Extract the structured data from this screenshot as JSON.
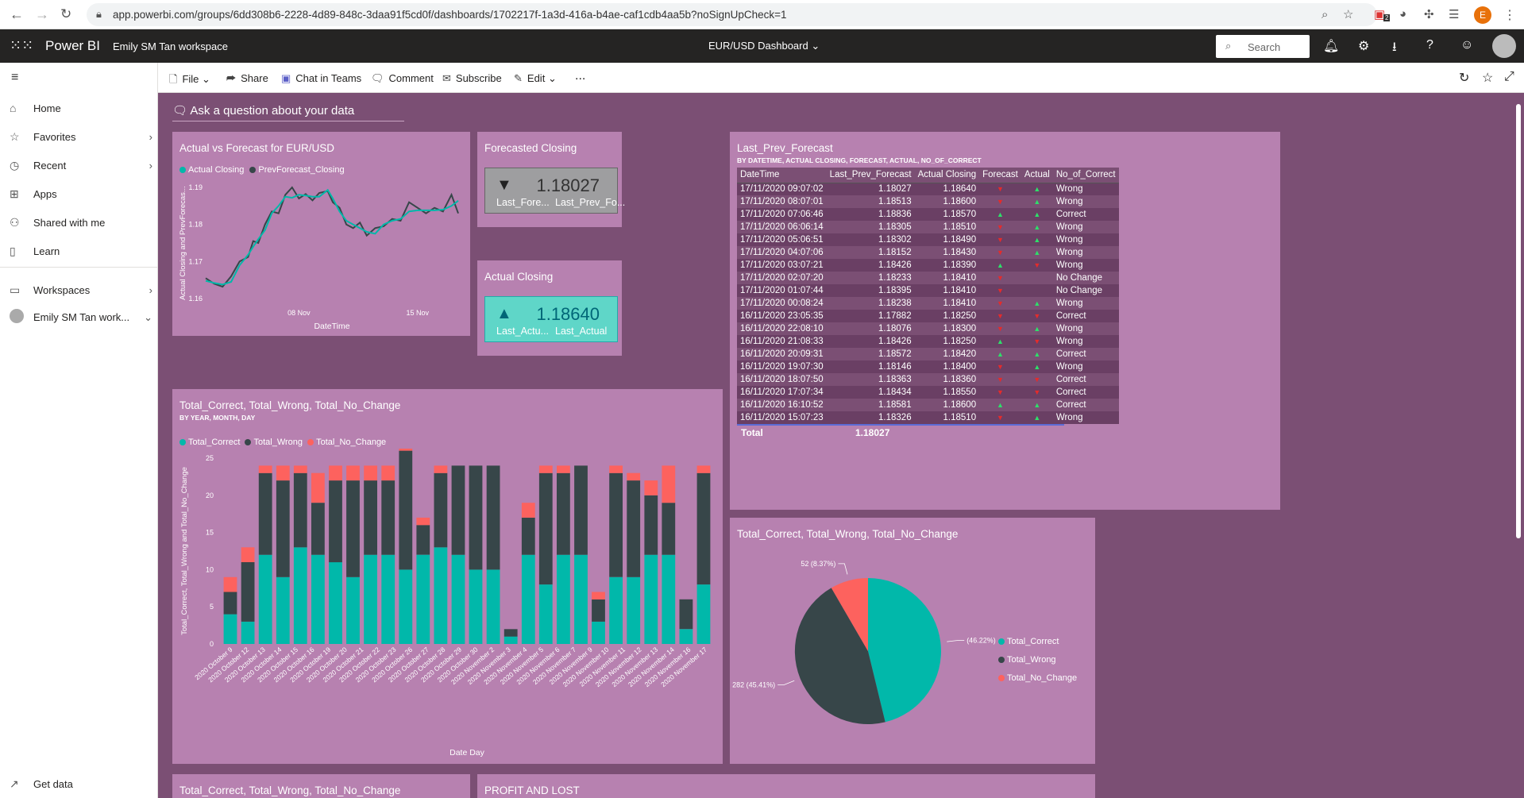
{
  "browser": {
    "url": "app.powerbi.com/groups/6dd308b6-2228-4d89-848c-3daa91f5cd0f/dashboards/1702217f-1a3d-416a-b4ae-caf1cdb4aa5b?noSignUpCheck=1",
    "profile_initial": "E",
    "extension_badge": "2"
  },
  "header": {
    "app_name": "Power BI",
    "workspace": "Emily SM Tan workspace",
    "dashboard_title": "EUR/USD Dashboard",
    "search_placeholder": "Search"
  },
  "sidebar": {
    "items": [
      {
        "label": "Home",
        "icon": "home-icon"
      },
      {
        "label": "Favorites",
        "icon": "star-icon"
      },
      {
        "label": "Recent",
        "icon": "clock-icon"
      },
      {
        "label": "Apps",
        "icon": "apps-icon"
      },
      {
        "label": "Shared with me",
        "icon": "share-person-icon"
      },
      {
        "label": "Learn",
        "icon": "book-icon"
      },
      {
        "label": "Workspaces",
        "icon": "workspaces-icon"
      },
      {
        "label": "Emily SM Tan work...",
        "icon": "workspace-avatar-icon"
      }
    ],
    "get_data": "Get data"
  },
  "toolbar": {
    "file": "File",
    "share": "Share",
    "teams": "Chat in Teams",
    "comment": "Comment",
    "subscribe": "Subscribe",
    "edit": "Edit",
    "more": "..."
  },
  "qa_prompt": "Ask a question about your data",
  "colors": {
    "canvas": "#7b4f74",
    "tile": "#b781b0",
    "correct": "#01b8aa",
    "wrong": "#374649",
    "no_change": "#fd625e",
    "up": "#2ee06a",
    "down": "#e52b2b"
  },
  "tiles": {
    "line": {
      "title": "Actual vs Forecast for EUR/USD",
      "legend": [
        "Actual Closing",
        "PrevForecast_Closing"
      ]
    },
    "forecast_card": {
      "title": "Forecasted Closing",
      "value": "1.18027",
      "arrow": "▼",
      "label1": "Last_Fore...",
      "label2": "Last_Prev_Fo..."
    },
    "actual_card": {
      "title": "Actual Closing",
      "value": "1.18640",
      "arrow": "▲",
      "label1": "Last_Actu...",
      "label2": "Last_Actual"
    },
    "table": {
      "title": "Last_Prev_Forecast",
      "subtitle": "BY DATETIME, ACTUAL CLOSING, FORECAST, ACTUAL, NO_OF_CORRECT",
      "headers": [
        "DateTime",
        "Last_Prev_Forecast",
        "Actual Closing",
        "Forecast",
        "Actual",
        "No_of_Correct"
      ],
      "rows": [
        [
          "17/11/2020 09:07:02",
          "1.18027",
          "1.18640",
          "down",
          "up",
          "Wrong"
        ],
        [
          "17/11/2020 08:07:01",
          "1.18513",
          "1.18600",
          "down",
          "up",
          "Wrong"
        ],
        [
          "17/11/2020 07:06:46",
          "1.18836",
          "1.18570",
          "up",
          "up",
          "Correct"
        ],
        [
          "17/11/2020 06:06:14",
          "1.18305",
          "1.18510",
          "down",
          "up",
          "Wrong"
        ],
        [
          "17/11/2020 05:06:51",
          "1.18302",
          "1.18490",
          "down",
          "up",
          "Wrong"
        ],
        [
          "17/11/2020 04:07:06",
          "1.18152",
          "1.18430",
          "down",
          "up",
          "Wrong"
        ],
        [
          "17/11/2020 03:07:21",
          "1.18426",
          "1.18390",
          "up",
          "down",
          "Wrong"
        ],
        [
          "17/11/2020 02:07:20",
          "1.18233",
          "1.18410",
          "down",
          "",
          "No Change"
        ],
        [
          "17/11/2020 01:07:44",
          "1.18395",
          "1.18410",
          "down",
          "",
          "No Change"
        ],
        [
          "17/11/2020 00:08:24",
          "1.18238",
          "1.18410",
          "down",
          "up",
          "Wrong"
        ],
        [
          "16/11/2020 23:05:35",
          "1.17882",
          "1.18250",
          "down",
          "down",
          "Correct"
        ],
        [
          "16/11/2020 22:08:10",
          "1.18076",
          "1.18300",
          "down",
          "up",
          "Wrong"
        ],
        [
          "16/11/2020 21:08:33",
          "1.18426",
          "1.18250",
          "up",
          "down",
          "Wrong"
        ],
        [
          "16/11/2020 20:09:31",
          "1.18572",
          "1.18420",
          "up",
          "up",
          "Correct"
        ],
        [
          "16/11/2020 19:07:30",
          "1.18146",
          "1.18400",
          "down",
          "up",
          "Wrong"
        ],
        [
          "16/11/2020 18:07:50",
          "1.18363",
          "1.18360",
          "down",
          "down",
          "Correct"
        ],
        [
          "16/11/2020 17:07:34",
          "1.18434",
          "1.18550",
          "down",
          "down",
          "Correct"
        ],
        [
          "16/11/2020 16:10:52",
          "1.18581",
          "1.18600",
          "up",
          "up",
          "Correct"
        ],
        [
          "16/11/2020 15:07:23",
          "1.18326",
          "1.18510",
          "down",
          "up",
          "Wrong"
        ]
      ],
      "total_label": "Total",
      "total_value": "1.18027"
    },
    "stacked": {
      "title": "Total_Correct, Total_Wrong, Total_No_Change",
      "subtitle": "BY YEAR, MONTH, DAY",
      "legend": [
        "Total_Correct",
        "Total_Wrong",
        "Total_No_Change"
      ]
    },
    "pie": {
      "title": "Total_Correct, Total_Wrong, Total_No_Change",
      "legend": [
        "Total_Correct",
        "Total_Wrong",
        "Total_No_Change"
      ]
    },
    "bottom_left": {
      "title": "Total_Correct, Total_Wrong, Total_No_Change"
    },
    "bottom_right": {
      "title": "PROFIT AND LOST"
    }
  },
  "chart_data": [
    {
      "type": "line",
      "title": "Actual vs Forecast for EUR/USD",
      "xlabel": "DateTime",
      "ylabel": "Actual Closing and PrevForecas...",
      "ylim": [
        1.16,
        1.19
      ],
      "y_ticks": [
        "1.16",
        "1.17",
        "1.18",
        "1.19"
      ],
      "x_ticks": [
        "08 Nov",
        "15 Nov"
      ],
      "x_tick_days": [
        8,
        15
      ],
      "xlim_days": [
        2.5,
        17.4
      ],
      "series": [
        {
          "name": "Actual Closing",
          "color": "#01b8aa",
          "x": [
            2.5,
            3.0,
            3.5,
            4.0,
            4.5,
            5.0,
            5.3,
            5.6,
            6.0,
            6.4,
            6.8,
            7.2,
            7.6,
            8.0,
            8.4,
            8.8,
            9.2,
            9.7,
            10.0,
            10.4,
            10.8,
            11.2,
            11.6,
            12.0,
            12.5,
            13.0,
            13.5,
            14.0,
            14.5,
            15.0,
            15.5,
            16.0,
            16.5,
            17.0,
            17.4
          ],
          "y": [
            1.1648,
            1.1642,
            1.1638,
            1.1645,
            1.169,
            1.1718,
            1.174,
            1.176,
            1.1785,
            1.183,
            1.185,
            1.1875,
            1.1872,
            1.188,
            1.1878,
            1.1875,
            1.1875,
            1.1893,
            1.187,
            1.1835,
            1.181,
            1.18,
            1.179,
            1.178,
            1.1775,
            1.18,
            1.181,
            1.1815,
            1.1835,
            1.1838,
            1.1838,
            1.1838,
            1.184,
            1.185,
            1.1864
          ]
        },
        {
          "name": "PrevForecast_Closing",
          "color": "#374649",
          "x": [
            2.5,
            3.0,
            3.5,
            4.0,
            4.5,
            5.0,
            5.3,
            5.6,
            6.0,
            6.4,
            6.8,
            7.2,
            7.6,
            8.0,
            8.4,
            8.8,
            9.2,
            9.7,
            10.0,
            10.4,
            10.8,
            11.2,
            11.6,
            12.0,
            12.5,
            13.0,
            13.5,
            14.0,
            14.5,
            15.0,
            15.5,
            16.0,
            16.5,
            17.0,
            17.4
          ],
          "y": [
            1.1655,
            1.164,
            1.1632,
            1.166,
            1.17,
            1.1712,
            1.1755,
            1.175,
            1.18,
            1.1835,
            1.183,
            1.188,
            1.19,
            1.187,
            1.1882,
            1.1865,
            1.1885,
            1.189,
            1.186,
            1.1845,
            1.18,
            1.179,
            1.1805,
            1.177,
            1.179,
            1.1795,
            1.1815,
            1.181,
            1.186,
            1.1845,
            1.183,
            1.1845,
            1.1835,
            1.188,
            1.183
          ]
        }
      ]
    },
    {
      "type": "bar",
      "title": "Total_Correct, Total_Wrong, Total_No_Change",
      "xlabel": "Date Day",
      "ylabel": "Total_Correct, Total_Wrong and Total_No_Change",
      "ylim": [
        0,
        25
      ],
      "y_ticks": [
        "0",
        "5",
        "10",
        "15",
        "20",
        "25"
      ],
      "categories": [
        "2020 October 9",
        "2020 October 12",
        "2020 October 13",
        "2020 October 14",
        "2020 October 15",
        "2020 October 16",
        "2020 October 19",
        "2020 October 20",
        "2020 October 21",
        "2020 October 22",
        "2020 October 23",
        "2020 October 26",
        "2020 October 27",
        "2020 October 28",
        "2020 October 29",
        "2020 October 30",
        "2020 November 2",
        "2020 November 3",
        "2020 November 4",
        "2020 November 5",
        "2020 November 6",
        "2020 November 9",
        "2020 November 10",
        "2020 November 11",
        "2020 November 12",
        "2020 November 13",
        "2020 November 16",
        "2020 November 17"
      ],
      "x_labels": [
        "2020 October 9",
        "2020 October 12",
        "2020 October 13",
        "2020 October 14",
        "2020 October 15",
        "2020 October 16",
        "2020 October 19",
        "2020 October 20",
        "2020 October 21",
        "2020 October 22",
        "2020 October 23",
        "2020 October 26",
        "2020 October 27",
        "2020 October 28",
        "2020 October 29",
        "2020 October 30",
        "2020 November 2",
        "2020 November 3",
        "2020 November 4",
        "2020 November 5",
        "2020 November 6",
        "2020 November 7",
        "2020 November 9",
        "2020 November 10",
        "2020 November 11",
        "2020 November 12",
        "2020 November 13",
        "2020 November 14",
        "2020 November 16",
        "2020 November 17"
      ],
      "series": [
        {
          "name": "Total_Correct",
          "color": "#01b8aa",
          "values": [
            4,
            3,
            12,
            9,
            13,
            12,
            11,
            9,
            12,
            12,
            10,
            12,
            13,
            12,
            10,
            10,
            1,
            12,
            8,
            12,
            12,
            3,
            9,
            9,
            12,
            12,
            2,
            8,
            1
          ]
        },
        {
          "name": "Total_Wrong",
          "color": "#374649",
          "values": [
            3,
            8,
            11,
            13,
            10,
            7,
            11,
            13,
            10,
            10,
            16,
            4,
            10,
            12,
            14,
            14,
            1,
            5,
            15,
            11,
            12,
            3,
            14,
            13,
            8,
            7,
            4,
            15,
            7
          ]
        },
        {
          "name": "Total_No_Change",
          "color": "#fd625e",
          "values": [
            2,
            2,
            1,
            2,
            1,
            4,
            2,
            2,
            2,
            2,
            2,
            1,
            1,
            0,
            0,
            0,
            0,
            2,
            1,
            1,
            0,
            1,
            1,
            1,
            2,
            5,
            0,
            1,
            2
          ]
        }
      ]
    },
    {
      "type": "pie",
      "title": "Total_Correct, Total_Wrong, Total_No_Change",
      "labels": [
        "Total_Correct",
        "Total_Wrong",
        "Total_No_Change"
      ],
      "values": [
        287,
        282,
        52
      ],
      "percent": [
        46.22,
        45.41,
        8.37
      ],
      "data_labels": [
        "(46.22%)",
        "282 (45.41%)",
        "52 (8.37%)"
      ],
      "colors": [
        "#01b8aa",
        "#374649",
        "#fd625e"
      ]
    }
  ]
}
